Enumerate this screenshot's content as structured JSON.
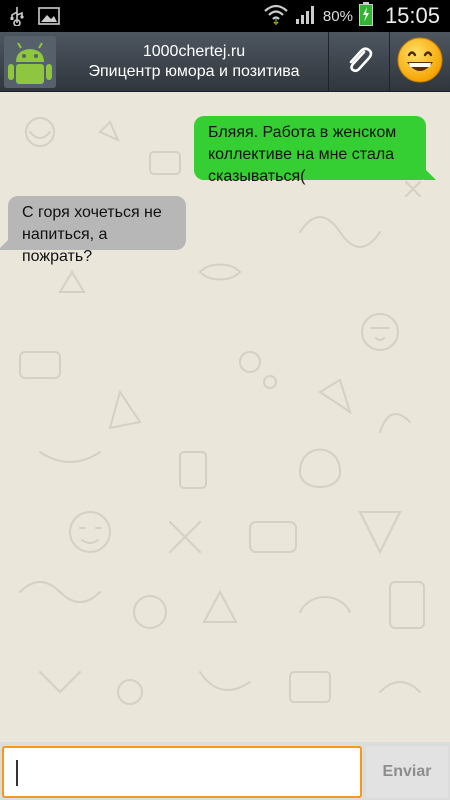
{
  "status_bar": {
    "battery": "80%",
    "time": "15:05"
  },
  "header": {
    "title": "1000chertej.ru",
    "subtitle": "Эпицентр юмора и позитива"
  },
  "messages": [
    {
      "direction": "outgoing",
      "text": "Бляяя. Работа в женском коллективе на мне стала сказываться("
    },
    {
      "direction": "incoming",
      "text": "С горя хочеться не напиться, а пожрать?"
    }
  ],
  "composer": {
    "input_value": "",
    "send_label": "Enviar"
  },
  "colors": {
    "outgoing_bubble": "#35cf34",
    "incoming_bubble": "#b7b7b7",
    "input_border": "#f39a1a",
    "chat_background": "#ebe6da",
    "header": "#3b424a"
  },
  "icons": {
    "status_left": [
      "usb-icon",
      "image-icon"
    ],
    "status_right": [
      "wifi-icon",
      "signal-icon",
      "battery-icon"
    ],
    "header": [
      "android-avatar-icon",
      "paperclip-icon",
      "smiley-icon"
    ]
  }
}
